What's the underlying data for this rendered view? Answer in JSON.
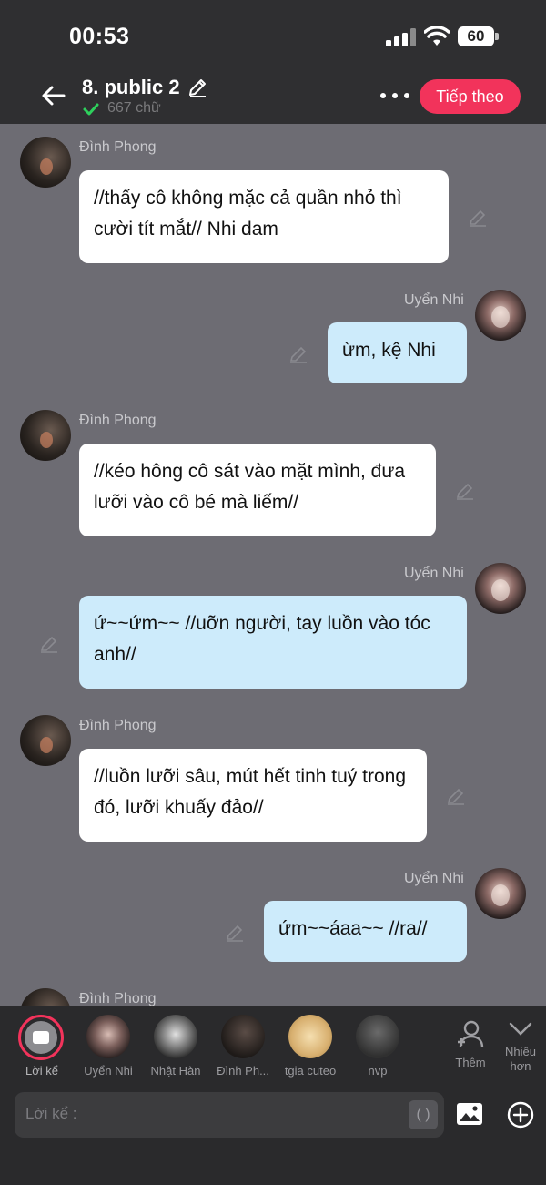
{
  "status_bar": {
    "time": "00:53",
    "battery": "60"
  },
  "header": {
    "title": "8. public 2",
    "word_count": "667 chữ",
    "next_label": "Tiếp theo"
  },
  "messages": [
    {
      "sender": "Đình Phong",
      "text": "//thấy cô không mặc cả quần nhỏ thì cười tít mắt// Nhi dam",
      "side": "left"
    },
    {
      "sender": "Uyển Nhi",
      "text": "ừm, kệ Nhi",
      "side": "right"
    },
    {
      "sender": "Đình Phong",
      "text": "//kéo hông cô sát vào mặt mình, đưa lưỡi vào cô bé mà liếm//",
      "side": "left"
    },
    {
      "sender": "Uyển Nhi",
      "text": "ứ~~ứm~~ //uỡn người, tay luồn vào tóc anh//",
      "side": "right"
    },
    {
      "sender": "Đình Phong",
      "text": "//luồn lưỡi sâu, mút hết tinh tuý trong đó, lưỡi khuấy đảo//",
      "side": "left"
    },
    {
      "sender": "Uyển Nhi",
      "text": "ứm~~áaa~~ //ra//",
      "side": "right"
    },
    {
      "sender": "Đình Phong",
      "text": "",
      "side": "left"
    }
  ],
  "characters": {
    "narrator": "Lời kể",
    "list": [
      "Uyển Nhi",
      "Nhật Hàn",
      "Đình Ph...",
      "tgia cuteo",
      "nvp"
    ],
    "add_label": "Thêm",
    "more_label": "Nhiều hơn"
  },
  "composer": {
    "placeholder": "Lời kể :",
    "bracket": "( )"
  },
  "colors": {
    "accent": "#f2335b",
    "bubble_right": "#cdebfb",
    "bubble_left": "#ffffff",
    "background": "#6d6c73"
  }
}
